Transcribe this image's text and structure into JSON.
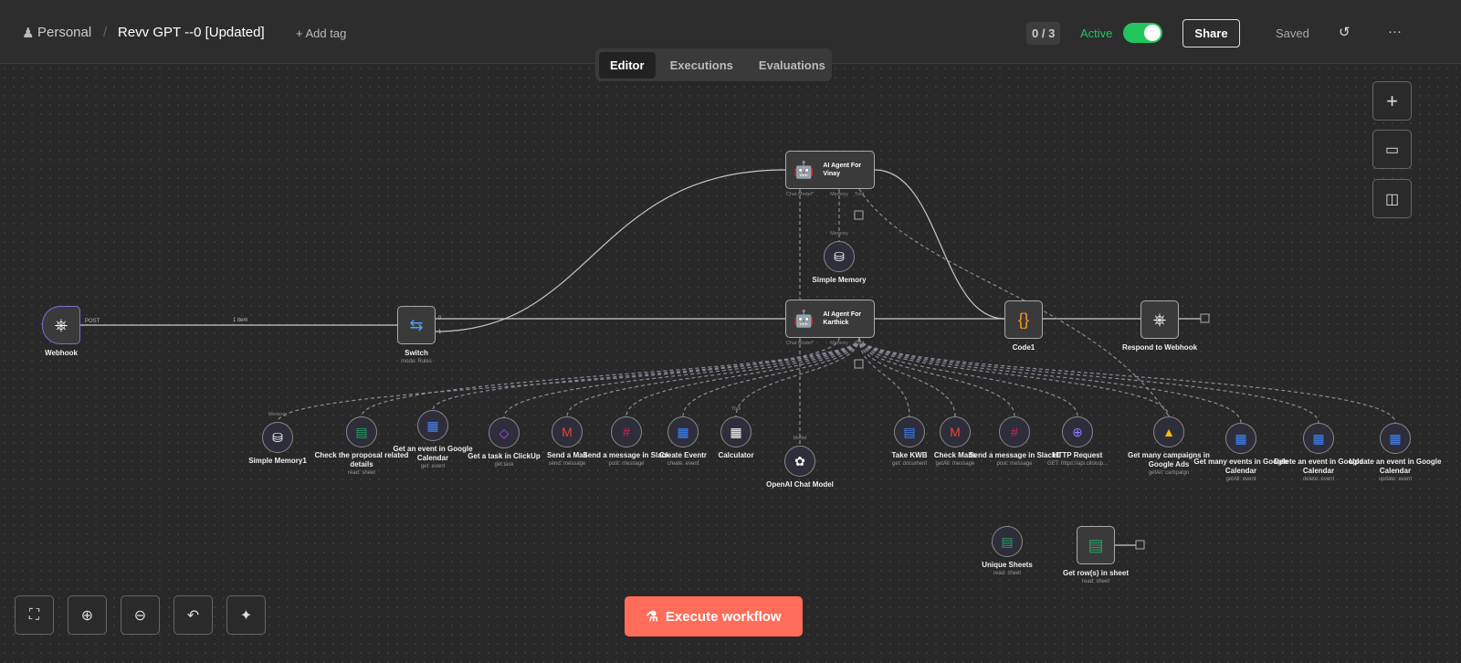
{
  "header": {
    "workspace": "Personal",
    "title": "Revv GPT --0 [Updated]",
    "add_tag": "+ Add tag",
    "counter": "0 / 3",
    "active_label": "Active",
    "active": true,
    "share": "Share",
    "saved": "Saved",
    "more": "···"
  },
  "tabs": [
    {
      "label": "Editor",
      "active": true
    },
    {
      "label": "Executions"
    },
    {
      "label": "Evaluations"
    }
  ],
  "edge_labels": {
    "webhook_out": "POST",
    "items": "1 item",
    "switch_out0": "0",
    "switch_out1": "1"
  },
  "nodes": [
    {
      "id": "webhook",
      "label": "Webhook",
      "icon": "webhook-icon"
    },
    {
      "id": "switch",
      "label": "Switch",
      "sub": "mode: Rules",
      "icon": "switch-icon"
    },
    {
      "id": "agent1",
      "label": "AI Agent For Vinay",
      "icon": "robot-icon",
      "ports": [
        "Chat Model*",
        "Memory",
        "Tool"
      ]
    },
    {
      "id": "agent2",
      "label": "AI Agent For Karthick",
      "icon": "robot-icon",
      "ports": [
        "Chat Model*",
        "Memory",
        "Tool"
      ]
    },
    {
      "id": "code",
      "label": "Code1",
      "icon": "code-icon"
    },
    {
      "id": "respond",
      "label": "Respond to Webhook",
      "icon": "webhook-icon"
    },
    {
      "id": "getrows",
      "label": "Get row(s) in sheet",
      "sub": "read: sheet",
      "icon": "sheets-icon"
    }
  ],
  "subnodes": [
    {
      "label": "Simple Memory",
      "icon": "database-icon",
      "port": "Memory"
    },
    {
      "label": "Simple Memory1",
      "icon": "database-icon",
      "port": "Memory"
    },
    {
      "label": "Check the proposal related details",
      "sub": "read: sheet",
      "icon": "sheets-icon"
    },
    {
      "label": "Get an event in Google Calendar",
      "sub": "get: event",
      "icon": "calendar-icon"
    },
    {
      "label": "Get a task in ClickUp",
      "sub": "get:task",
      "icon": "clickup-icon"
    },
    {
      "label": "Send a Mail",
      "sub": "send: message",
      "icon": "gmail-icon"
    },
    {
      "label": "Send a message in Slack",
      "sub": "post: message",
      "icon": "slack-icon"
    },
    {
      "label": "Create Eventr",
      "sub": "create: event",
      "icon": "calendar-icon"
    },
    {
      "label": "Calculator",
      "icon": "calculator-icon",
      "port": "Tool"
    },
    {
      "label": "OpenAI Chat Model",
      "icon": "openai-icon",
      "port": "Model"
    },
    {
      "label": "Take KWB",
      "sub": "get: document",
      "icon": "docs-icon"
    },
    {
      "label": "Check Mails",
      "sub": "getAll: message",
      "icon": "gmail-icon"
    },
    {
      "label": "Send a message in Slack1",
      "sub": "post: message",
      "icon": "slack-icon"
    },
    {
      "label": "HTTP Request",
      "sub": "GET: https://api.clickup...",
      "icon": "globe-icon"
    },
    {
      "label": "Get many campaigns in Google Ads",
      "sub": "getAll: campaign",
      "icon": "google-ads-icon"
    },
    {
      "label": "Get many events in Google Calendar",
      "sub": "getAll: event",
      "icon": "calendar-icon"
    },
    {
      "label": "Delete an event in Google Calendar",
      "sub": "delete: event",
      "icon": "calendar-icon"
    },
    {
      "label": "Update an event in Google Calendar",
      "sub": "update: event",
      "icon": "calendar-icon"
    },
    {
      "label": "Unique Sheets",
      "sub": "read: sheet",
      "icon": "sheets-icon"
    }
  ],
  "execute": "Execute workflow",
  "colors": {
    "accent": "#ff6d5a",
    "active": "#23c55e"
  }
}
